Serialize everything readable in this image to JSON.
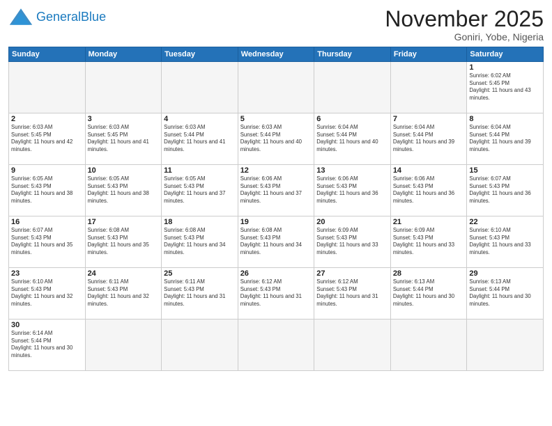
{
  "header": {
    "logo_general": "General",
    "logo_blue": "Blue",
    "month_title": "November 2025",
    "location": "Goniri, Yobe, Nigeria"
  },
  "weekdays": [
    "Sunday",
    "Monday",
    "Tuesday",
    "Wednesday",
    "Thursday",
    "Friday",
    "Saturday"
  ],
  "days": [
    {
      "date": "1",
      "sunrise": "6:02 AM",
      "sunset": "5:45 PM",
      "daylight": "11 hours and 43 minutes."
    },
    {
      "date": "2",
      "sunrise": "6:03 AM",
      "sunset": "5:45 PM",
      "daylight": "11 hours and 42 minutes."
    },
    {
      "date": "3",
      "sunrise": "6:03 AM",
      "sunset": "5:45 PM",
      "daylight": "11 hours and 41 minutes."
    },
    {
      "date": "4",
      "sunrise": "6:03 AM",
      "sunset": "5:44 PM",
      "daylight": "11 hours and 41 minutes."
    },
    {
      "date": "5",
      "sunrise": "6:03 AM",
      "sunset": "5:44 PM",
      "daylight": "11 hours and 40 minutes."
    },
    {
      "date": "6",
      "sunrise": "6:04 AM",
      "sunset": "5:44 PM",
      "daylight": "11 hours and 40 minutes."
    },
    {
      "date": "7",
      "sunrise": "6:04 AM",
      "sunset": "5:44 PM",
      "daylight": "11 hours and 39 minutes."
    },
    {
      "date": "8",
      "sunrise": "6:04 AM",
      "sunset": "5:44 PM",
      "daylight": "11 hours and 39 minutes."
    },
    {
      "date": "9",
      "sunrise": "6:05 AM",
      "sunset": "5:43 PM",
      "daylight": "11 hours and 38 minutes."
    },
    {
      "date": "10",
      "sunrise": "6:05 AM",
      "sunset": "5:43 PM",
      "daylight": "11 hours and 38 minutes."
    },
    {
      "date": "11",
      "sunrise": "6:05 AM",
      "sunset": "5:43 PM",
      "daylight": "11 hours and 37 minutes."
    },
    {
      "date": "12",
      "sunrise": "6:06 AM",
      "sunset": "5:43 PM",
      "daylight": "11 hours and 37 minutes."
    },
    {
      "date": "13",
      "sunrise": "6:06 AM",
      "sunset": "5:43 PM",
      "daylight": "11 hours and 36 minutes."
    },
    {
      "date": "14",
      "sunrise": "6:06 AM",
      "sunset": "5:43 PM",
      "daylight": "11 hours and 36 minutes."
    },
    {
      "date": "15",
      "sunrise": "6:07 AM",
      "sunset": "5:43 PM",
      "daylight": "11 hours and 36 minutes."
    },
    {
      "date": "16",
      "sunrise": "6:07 AM",
      "sunset": "5:43 PM",
      "daylight": "11 hours and 35 minutes."
    },
    {
      "date": "17",
      "sunrise": "6:08 AM",
      "sunset": "5:43 PM",
      "daylight": "11 hours and 35 minutes."
    },
    {
      "date": "18",
      "sunrise": "6:08 AM",
      "sunset": "5:43 PM",
      "daylight": "11 hours and 34 minutes."
    },
    {
      "date": "19",
      "sunrise": "6:08 AM",
      "sunset": "5:43 PM",
      "daylight": "11 hours and 34 minutes."
    },
    {
      "date": "20",
      "sunrise": "6:09 AM",
      "sunset": "5:43 PM",
      "daylight": "11 hours and 33 minutes."
    },
    {
      "date": "21",
      "sunrise": "6:09 AM",
      "sunset": "5:43 PM",
      "daylight": "11 hours and 33 minutes."
    },
    {
      "date": "22",
      "sunrise": "6:10 AM",
      "sunset": "5:43 PM",
      "daylight": "11 hours and 33 minutes."
    },
    {
      "date": "23",
      "sunrise": "6:10 AM",
      "sunset": "5:43 PM",
      "daylight": "11 hours and 32 minutes."
    },
    {
      "date": "24",
      "sunrise": "6:11 AM",
      "sunset": "5:43 PM",
      "daylight": "11 hours and 32 minutes."
    },
    {
      "date": "25",
      "sunrise": "6:11 AM",
      "sunset": "5:43 PM",
      "daylight": "11 hours and 31 minutes."
    },
    {
      "date": "26",
      "sunrise": "6:12 AM",
      "sunset": "5:43 PM",
      "daylight": "11 hours and 31 minutes."
    },
    {
      "date": "27",
      "sunrise": "6:12 AM",
      "sunset": "5:43 PM",
      "daylight": "11 hours and 31 minutes."
    },
    {
      "date": "28",
      "sunrise": "6:13 AM",
      "sunset": "5:44 PM",
      "daylight": "11 hours and 30 minutes."
    },
    {
      "date": "29",
      "sunrise": "6:13 AM",
      "sunset": "5:44 PM",
      "daylight": "11 hours and 30 minutes."
    },
    {
      "date": "30",
      "sunrise": "6:14 AM",
      "sunset": "5:44 PM",
      "daylight": "11 hours and 30 minutes."
    }
  ],
  "labels": {
    "sunrise": "Sunrise:",
    "sunset": "Sunset:",
    "daylight": "Daylight:"
  }
}
